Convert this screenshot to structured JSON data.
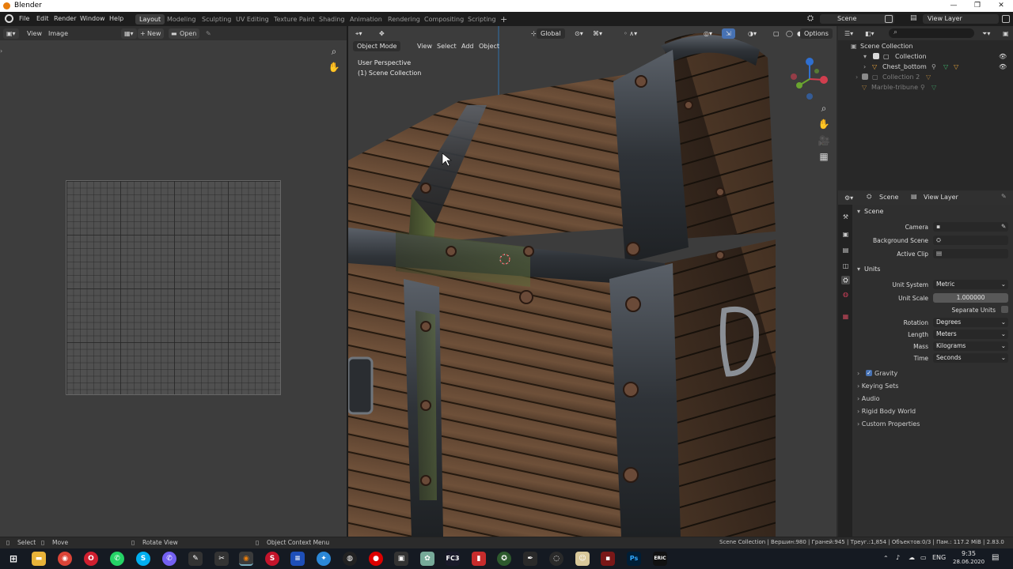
{
  "window": {
    "title": "Blender",
    "minimize": "—",
    "maximize": "❐",
    "close": "✕"
  },
  "menu": {
    "items": [
      "File",
      "Edit",
      "Render",
      "Window",
      "Help"
    ]
  },
  "workspaces": {
    "tabs": [
      "Layout",
      "Modeling",
      "Sculpting",
      "UV Editing",
      "Texture Paint",
      "Shading",
      "Animation",
      "Rendering",
      "Compositing",
      "Scripting"
    ],
    "active": "Layout",
    "add": "+"
  },
  "top_right": {
    "scene": "Scene",
    "view_layer": "View Layer"
  },
  "image_editor": {
    "view": "View",
    "image": "Image",
    "new": "New",
    "open": "Open"
  },
  "viewport": {
    "mode": "Object Mode",
    "menus": [
      "View",
      "Select",
      "Add",
      "Object"
    ],
    "orientation": "Global",
    "options": "Options",
    "perspective": "User Perspective",
    "collection": "(1) Scene Collection"
  },
  "outliner": {
    "search_placeholder": "",
    "rows": [
      {
        "label": "Scene Collection",
        "dim": false
      },
      {
        "label": "Collection",
        "dim": false
      },
      {
        "label": "Chest_bottom",
        "dim": false
      },
      {
        "label": "Collection 2",
        "dim": true
      },
      {
        "label": "Marble-tribune",
        "dim": true
      }
    ]
  },
  "properties": {
    "header_scene": "Scene",
    "header_view_layer": "View Layer",
    "scene_panel": "Scene",
    "camera_label": "Camera",
    "background_scene_label": "Background Scene",
    "active_clip_label": "Active Clip",
    "units_panel": "Units",
    "unit_system_label": "Unit System",
    "unit_system": "Metric",
    "unit_scale_label": "Unit Scale",
    "unit_scale": "1.000000",
    "separate_units_label": "Separate Units",
    "rotation_label": "Rotation",
    "rotation": "Degrees",
    "length_label": "Length",
    "length": "Meters",
    "mass_label": "Mass",
    "mass": "Kilograms",
    "time_label": "Time",
    "time": "Seconds",
    "subpanels": [
      "Gravity",
      "Keying Sets",
      "Audio",
      "Rigid Body World",
      "Custom Properties"
    ]
  },
  "statusbar": {
    "select": "Select",
    "move": "Move",
    "rotate": "Rotate View",
    "context": "Object Context Menu",
    "stats": "Scene Collection | Вершин:980 | Граней:945 | Треуг.:1,854 | Объектов:0/3 | Пам.: 117.2 MiB | 2.83.0"
  },
  "taskbar": {
    "lang": "ENG",
    "time": "9:35",
    "date": "28.06.2020",
    "fc3": "FC3",
    "ps": "Ps",
    "eric": "ERIC"
  },
  "colors": {
    "accent": "#4772b3",
    "chest_wood": "#6b4a33",
    "metal": "#3a3e45",
    "blender_orange": "#e87d0d"
  }
}
